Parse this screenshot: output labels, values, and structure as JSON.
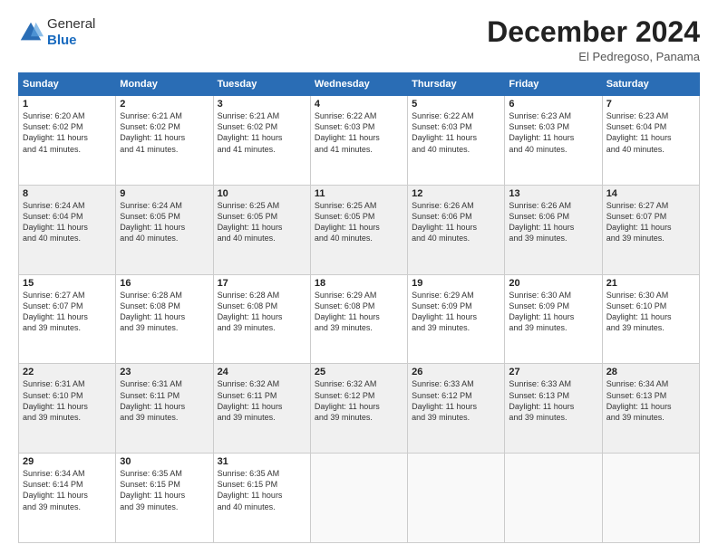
{
  "header": {
    "logo_general": "General",
    "logo_blue": "Blue",
    "month_title": "December 2024",
    "location": "El Pedregoso, Panama"
  },
  "days_of_week": [
    "Sunday",
    "Monday",
    "Tuesday",
    "Wednesday",
    "Thursday",
    "Friday",
    "Saturday"
  ],
  "weeks": [
    [
      {
        "day": "1",
        "info": "Sunrise: 6:20 AM\nSunset: 6:02 PM\nDaylight: 11 hours\nand 41 minutes."
      },
      {
        "day": "2",
        "info": "Sunrise: 6:21 AM\nSunset: 6:02 PM\nDaylight: 11 hours\nand 41 minutes."
      },
      {
        "day": "3",
        "info": "Sunrise: 6:21 AM\nSunset: 6:02 PM\nDaylight: 11 hours\nand 41 minutes."
      },
      {
        "day": "4",
        "info": "Sunrise: 6:22 AM\nSunset: 6:03 PM\nDaylight: 11 hours\nand 41 minutes."
      },
      {
        "day": "5",
        "info": "Sunrise: 6:22 AM\nSunset: 6:03 PM\nDaylight: 11 hours\nand 40 minutes."
      },
      {
        "day": "6",
        "info": "Sunrise: 6:23 AM\nSunset: 6:03 PM\nDaylight: 11 hours\nand 40 minutes."
      },
      {
        "day": "7",
        "info": "Sunrise: 6:23 AM\nSunset: 6:04 PM\nDaylight: 11 hours\nand 40 minutes."
      }
    ],
    [
      {
        "day": "8",
        "info": "Sunrise: 6:24 AM\nSunset: 6:04 PM\nDaylight: 11 hours\nand 40 minutes."
      },
      {
        "day": "9",
        "info": "Sunrise: 6:24 AM\nSunset: 6:05 PM\nDaylight: 11 hours\nand 40 minutes."
      },
      {
        "day": "10",
        "info": "Sunrise: 6:25 AM\nSunset: 6:05 PM\nDaylight: 11 hours\nand 40 minutes."
      },
      {
        "day": "11",
        "info": "Sunrise: 6:25 AM\nSunset: 6:05 PM\nDaylight: 11 hours\nand 40 minutes."
      },
      {
        "day": "12",
        "info": "Sunrise: 6:26 AM\nSunset: 6:06 PM\nDaylight: 11 hours\nand 40 minutes."
      },
      {
        "day": "13",
        "info": "Sunrise: 6:26 AM\nSunset: 6:06 PM\nDaylight: 11 hours\nand 39 minutes."
      },
      {
        "day": "14",
        "info": "Sunrise: 6:27 AM\nSunset: 6:07 PM\nDaylight: 11 hours\nand 39 minutes."
      }
    ],
    [
      {
        "day": "15",
        "info": "Sunrise: 6:27 AM\nSunset: 6:07 PM\nDaylight: 11 hours\nand 39 minutes."
      },
      {
        "day": "16",
        "info": "Sunrise: 6:28 AM\nSunset: 6:08 PM\nDaylight: 11 hours\nand 39 minutes."
      },
      {
        "day": "17",
        "info": "Sunrise: 6:28 AM\nSunset: 6:08 PM\nDaylight: 11 hours\nand 39 minutes."
      },
      {
        "day": "18",
        "info": "Sunrise: 6:29 AM\nSunset: 6:08 PM\nDaylight: 11 hours\nand 39 minutes."
      },
      {
        "day": "19",
        "info": "Sunrise: 6:29 AM\nSunset: 6:09 PM\nDaylight: 11 hours\nand 39 minutes."
      },
      {
        "day": "20",
        "info": "Sunrise: 6:30 AM\nSunset: 6:09 PM\nDaylight: 11 hours\nand 39 minutes."
      },
      {
        "day": "21",
        "info": "Sunrise: 6:30 AM\nSunset: 6:10 PM\nDaylight: 11 hours\nand 39 minutes."
      }
    ],
    [
      {
        "day": "22",
        "info": "Sunrise: 6:31 AM\nSunset: 6:10 PM\nDaylight: 11 hours\nand 39 minutes."
      },
      {
        "day": "23",
        "info": "Sunrise: 6:31 AM\nSunset: 6:11 PM\nDaylight: 11 hours\nand 39 minutes."
      },
      {
        "day": "24",
        "info": "Sunrise: 6:32 AM\nSunset: 6:11 PM\nDaylight: 11 hours\nand 39 minutes."
      },
      {
        "day": "25",
        "info": "Sunrise: 6:32 AM\nSunset: 6:12 PM\nDaylight: 11 hours\nand 39 minutes."
      },
      {
        "day": "26",
        "info": "Sunrise: 6:33 AM\nSunset: 6:12 PM\nDaylight: 11 hours\nand 39 minutes."
      },
      {
        "day": "27",
        "info": "Sunrise: 6:33 AM\nSunset: 6:13 PM\nDaylight: 11 hours\nand 39 minutes."
      },
      {
        "day": "28",
        "info": "Sunrise: 6:34 AM\nSunset: 6:13 PM\nDaylight: 11 hours\nand 39 minutes."
      }
    ],
    [
      {
        "day": "29",
        "info": "Sunrise: 6:34 AM\nSunset: 6:14 PM\nDaylight: 11 hours\nand 39 minutes."
      },
      {
        "day": "30",
        "info": "Sunrise: 6:35 AM\nSunset: 6:15 PM\nDaylight: 11 hours\nand 39 minutes."
      },
      {
        "day": "31",
        "info": "Sunrise: 6:35 AM\nSunset: 6:15 PM\nDaylight: 11 hours\nand 40 minutes."
      },
      {
        "day": "",
        "info": ""
      },
      {
        "day": "",
        "info": ""
      },
      {
        "day": "",
        "info": ""
      },
      {
        "day": "",
        "info": ""
      }
    ]
  ]
}
